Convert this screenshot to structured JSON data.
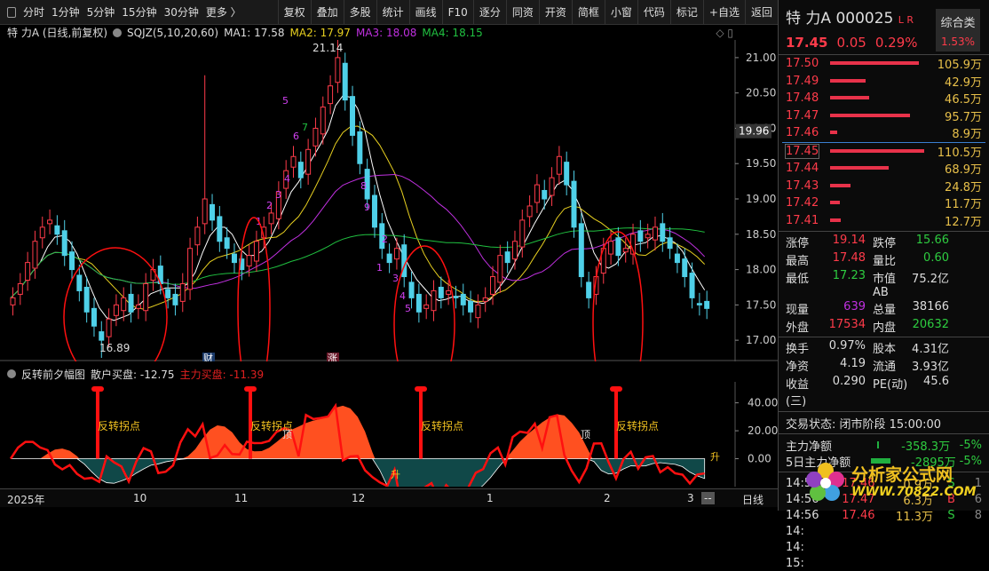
{
  "toolbar": {
    "periods": [
      "分时",
      "1分钟",
      "5分钟",
      "15分钟",
      "30分钟",
      "更多 〉"
    ],
    "buttons": [
      "复权",
      "叠加",
      "多股",
      "统计",
      "画线",
      "F10",
      "逐分",
      "同资",
      "开资",
      "简框",
      "小窗",
      "代码",
      "标记",
      "+自选",
      "返回"
    ]
  },
  "info": {
    "title": "特 力A (日线,前复权)",
    "indicator": "SQJZ(5,10,20,60)",
    "ma1": "MA1: 17.58",
    "ma2": "MA2: 17.97",
    "ma3": "MA3: 18.08",
    "ma4": "MA4: 18.15"
  },
  "colors": {
    "up": "#ff3b4a",
    "down": "#4fd0e8",
    "ma1": "#ffffff",
    "ma2": "#e8d020",
    "ma3": "#c030e0",
    "ma4": "#20c040"
  },
  "chart_data": {
    "type": "candlestick",
    "price_ticks": [
      "21.00",
      "20.50",
      "20.00",
      "19.50",
      "19.00",
      "18.50",
      "18.00",
      "17.50",
      "17.00"
    ],
    "price_range": [
      16.7,
      21.25
    ],
    "current_price_label": "19.96",
    "closes": [
      17.6,
      17.8,
      18.1,
      18.4,
      18.6,
      18.7,
      18.5,
      18.2,
      18.0,
      17.7,
      17.4,
      17.2,
      17.0,
      17.3,
      17.5,
      17.6,
      17.4,
      17.5,
      17.8,
      18.0,
      17.8,
      17.6,
      17.5,
      17.8,
      18.3,
      18.6,
      19.0,
      18.7,
      18.4,
      18.3,
      18.1,
      18.0,
      18.2,
      18.4,
      18.6,
      18.8,
      19.1,
      19.4,
      19.6,
      19.3,
      19.7,
      20.0,
      20.3,
      20.6,
      21.0,
      20.4,
      19.9,
      19.5,
      19.0,
      18.6,
      18.3,
      18.1,
      18.3,
      17.9,
      17.6,
      17.4,
      17.5,
      17.7,
      17.6,
      17.7,
      17.6,
      17.5,
      17.4,
      17.5,
      17.6,
      17.9,
      18.2,
      18.1,
      18.4,
      18.7,
      18.9,
      19.2,
      19.0,
      19.3,
      19.6,
      19.2,
      18.6,
      17.9,
      17.6,
      17.9,
      18.3,
      18.4,
      18.2,
      18.3,
      18.5,
      18.4,
      18.5,
      18.6,
      18.4,
      18.3,
      18.1,
      17.9,
      17.6,
      17.5,
      17.45
    ],
    "high_label": "21.14",
    "low_label": "16.89",
    "event_labels": [
      "财",
      "涨"
    ],
    "wave_numbers": [
      "1",
      "2",
      "3",
      "4",
      "5",
      "6",
      "7",
      "8",
      "9"
    ],
    "indicator": {
      "name": "反转前夕幅图",
      "retail_label": "散户买盘: -12.75",
      "main_label": "主力买盘: -11.39",
      "ticks": [
        "40.00",
        "20.00",
        "0.00"
      ],
      "range": [
        -20,
        55
      ],
      "signals": [
        "反转拐点",
        "反转拐点",
        "反转拐点",
        "反转拐点"
      ],
      "tops": [
        "顶",
        "顶"
      ],
      "rises": [
        "升",
        "升"
      ]
    },
    "time_ticks": [
      "2025年",
      "10",
      "11",
      "12",
      "1",
      "2",
      "3"
    ],
    "period_label": "日线",
    "scroll_label": "--"
  },
  "quote": {
    "name": "特 力A",
    "code": "000025",
    "flags": "L R",
    "price": "17.45",
    "change": "0.05",
    "pct": "0.29%",
    "sector": "综合类",
    "sector_pct": "1.53%",
    "asks": [
      {
        "p": "17.50",
        "v": "105.9万",
        "w": 100
      },
      {
        "p": "17.49",
        "v": "42.9万",
        "w": 40
      },
      {
        "p": "17.48",
        "v": "46.5万",
        "w": 44
      },
      {
        "p": "17.47",
        "v": "95.7万",
        "w": 90
      },
      {
        "p": "17.46",
        "v": "8.9万",
        "w": 8
      }
    ],
    "bids": [
      {
        "p": "17.45",
        "v": "110.5万",
        "w": 106
      },
      {
        "p": "17.44",
        "v": "68.9万",
        "w": 66
      },
      {
        "p": "17.43",
        "v": "24.8万",
        "w": 23
      },
      {
        "p": "17.42",
        "v": "11.7万",
        "w": 11
      },
      {
        "p": "17.41",
        "v": "12.7万",
        "w": 12
      }
    ],
    "stats": [
      [
        "涨停",
        "19.14",
        "跌停",
        "15.66"
      ],
      [
        "最高",
        "17.48",
        "量比",
        "0.60"
      ],
      [
        "最低",
        "17.23",
        "市值AB",
        "75.2亿"
      ],
      [
        "现量",
        "639",
        "总量",
        "38166"
      ],
      [
        "外盘",
        "17534",
        "内盘",
        "20632"
      ]
    ],
    "stats2": [
      [
        "换手",
        "0.97%",
        "股本",
        "4.31亿"
      ],
      [
        "净资",
        "4.19",
        "流通",
        "3.93亿"
      ],
      [
        "收益(三)",
        "0.290",
        "PE(动)",
        "45.6"
      ]
    ],
    "status": "交易状态: 闭市阶段 15:00:00",
    "flow": [
      {
        "label": "主力净额",
        "value": "-358.3万",
        "pct": "-5%"
      },
      {
        "label": "5日主力净额",
        "value": "-2895万",
        "pct": "-5%"
      }
    ],
    "ticks": [
      [
        "14:56",
        "17.46",
        "0.9万",
        "S",
        "1"
      ],
      [
        "14:56",
        "17.47",
        "6.3万",
        "B",
        "6"
      ],
      [
        "14:56",
        "17.46",
        "11.3万",
        "S",
        "8"
      ],
      [
        "14:",
        "",
        "",
        "",
        ""
      ],
      [
        "14:",
        "",
        "",
        "",
        ""
      ],
      [
        "15:",
        "",
        "",
        "",
        ""
      ]
    ],
    "logo_text": "分析家公式网",
    "logo_url": "WWW.70822.COM"
  }
}
